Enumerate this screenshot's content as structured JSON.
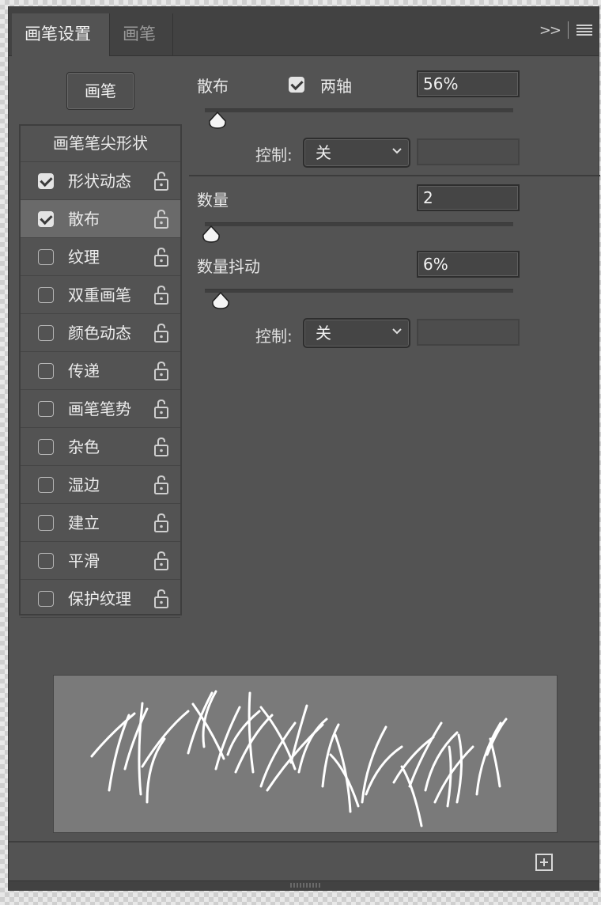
{
  "tabs": {
    "active": "画笔设置",
    "inactive": "画笔"
  },
  "brush_button_label": "画笔",
  "list": {
    "header": "画笔笔尖形状",
    "items": [
      {
        "label": "形状动态",
        "checked": true,
        "selected": false
      },
      {
        "label": "散布",
        "checked": true,
        "selected": true
      },
      {
        "label": "纹理",
        "checked": false,
        "selected": false
      },
      {
        "label": "双重画笔",
        "checked": false,
        "selected": false
      },
      {
        "label": "颜色动态",
        "checked": false,
        "selected": false
      },
      {
        "label": "传递",
        "checked": false,
        "selected": false
      },
      {
        "label": "画笔笔势",
        "checked": false,
        "selected": false
      },
      {
        "label": "杂色",
        "checked": false,
        "selected": false
      },
      {
        "label": "湿边",
        "checked": false,
        "selected": false
      },
      {
        "label": "建立",
        "checked": false,
        "selected": false
      },
      {
        "label": "平滑",
        "checked": false,
        "selected": false
      },
      {
        "label": "保护纹理",
        "checked": false,
        "selected": false
      }
    ]
  },
  "scatter": {
    "label": "散布",
    "both_axes_label": "两轴",
    "both_axes_checked": true,
    "value": "56%",
    "slider_fraction": 0.04,
    "control_label": "控制:",
    "control_value": "关"
  },
  "count": {
    "label": "数量",
    "value": "2",
    "slider_fraction": 0.02
  },
  "count_jitter": {
    "label": "数量抖动",
    "value": "6%",
    "slider_fraction": 0.05,
    "control_label": "控制:",
    "control_value": "关"
  }
}
